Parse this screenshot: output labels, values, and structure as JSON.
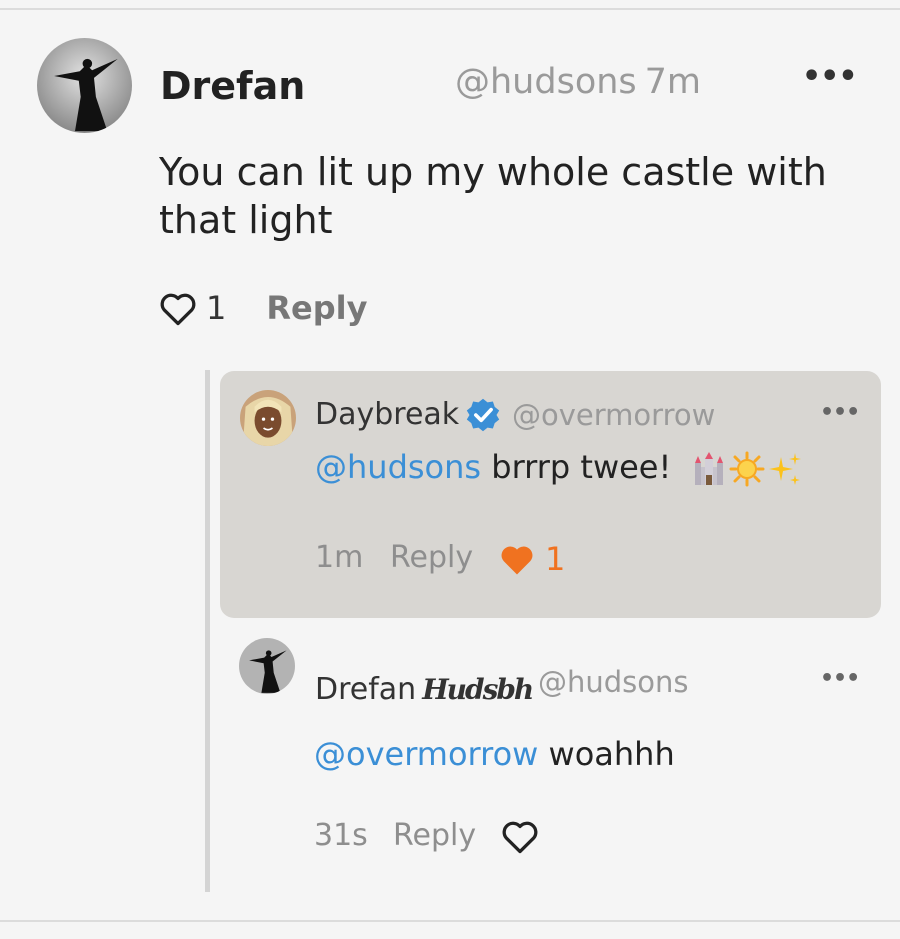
{
  "comment": {
    "author": "Drefan",
    "handle": "@hudsons",
    "time": "7m",
    "text": "You can lit up my whole castle with that light",
    "like_count": "1",
    "reply_label": "Reply",
    "more_label": "•••"
  },
  "replies": [
    {
      "author": "Daybreak",
      "handle": "@overmorrow",
      "verified": true,
      "mention": "@hudsons",
      "text": " brrrp twee!",
      "emojis": [
        "castle-emoji",
        "sun-emoji",
        "sparkles-emoji"
      ],
      "time": "1m",
      "reply_label": "Reply",
      "like_count": "1",
      "liked": true,
      "more_label": "•••"
    },
    {
      "author": "Drefan",
      "signature": "Hudsbh",
      "handle": "@hudsons",
      "mention": "@overmorrow",
      "text": " woahhh",
      "time": "31s",
      "reply_label": "Reply",
      "liked": false,
      "more_label": "•••"
    }
  ],
  "colors": {
    "mention": "#3b8fd6",
    "liked_heart": "#f07220",
    "highlight_card": "#d8d6d2",
    "verified_badge": "#3b8fd6"
  }
}
